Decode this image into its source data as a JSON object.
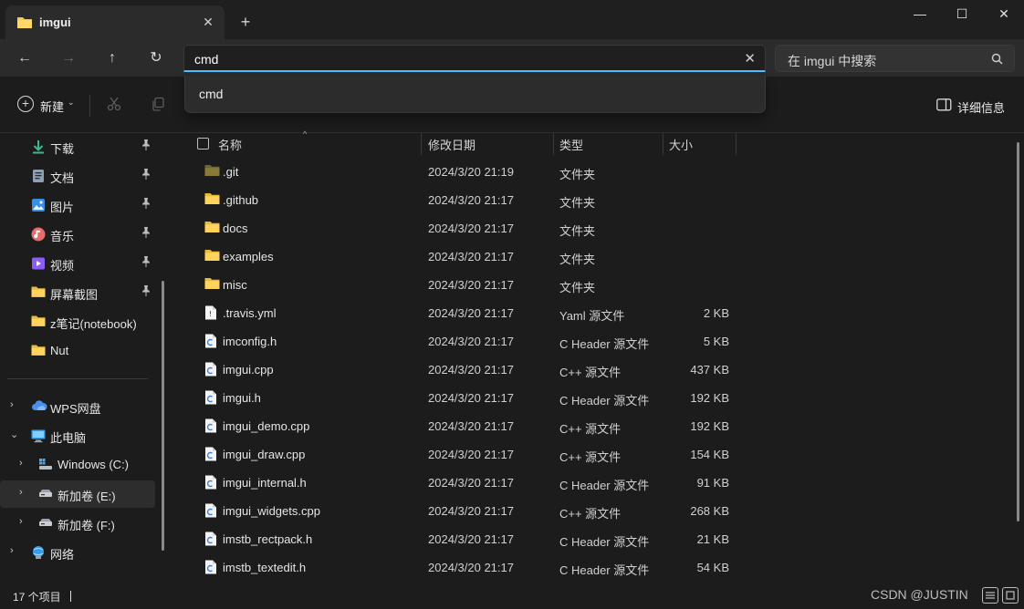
{
  "window": {
    "tab_title": "imgui",
    "tab_close": "✕",
    "new_tab": "+",
    "minimize": "—",
    "maximize": "☐",
    "close": "✕"
  },
  "nav": {
    "back": "←",
    "forward": "→",
    "up": "↑",
    "refresh": "↻",
    "address_value": "cmd",
    "address_clear": "✕",
    "search_placeholder": "在 imgui 中搜索",
    "suggestion": "cmd"
  },
  "commandbar": {
    "new_label": "新建",
    "new_plus": "+",
    "new_chevron": "⌄",
    "details_label": "详细信息"
  },
  "sidebar": {
    "quick_access": [
      {
        "label": "下载",
        "icon": "download-icon",
        "pinned": true
      },
      {
        "label": "文档",
        "icon": "document-icon",
        "pinned": true
      },
      {
        "label": "图片",
        "icon": "pictures-icon",
        "pinned": true
      },
      {
        "label": "音乐",
        "icon": "music-icon",
        "pinned": true
      },
      {
        "label": "视频",
        "icon": "video-icon",
        "pinned": true
      },
      {
        "label": "屏幕截图",
        "icon": "folder-icon",
        "pinned": true
      },
      {
        "label": "z笔记(notebook)",
        "icon": "folder-icon",
        "pinned": false
      },
      {
        "label": "Nut",
        "icon": "folder-icon",
        "pinned": false
      }
    ],
    "tree": [
      {
        "label": "WPS网盘",
        "icon": "cloud-icon",
        "arrow": "›"
      },
      {
        "label": "此电脑",
        "icon": "computer-icon",
        "arrow": "⌄"
      },
      {
        "label": "Windows (C:)",
        "icon": "drive-icon",
        "arrow": "›"
      },
      {
        "label": "新加卷 (E:)",
        "icon": "drive-icon",
        "arrow": "›"
      },
      {
        "label": "新加卷 (F:)",
        "icon": "drive-icon",
        "arrow": "›"
      },
      {
        "label": "网络",
        "icon": "network-icon",
        "arrow": "›"
      }
    ],
    "pin_glyph": "📌"
  },
  "columns": {
    "name": "名称",
    "date": "修改日期",
    "type": "类型",
    "size": "大小",
    "sort_caret": "^"
  },
  "files": [
    {
      "name": ".git",
      "date": "2024/3/20 21:19",
      "type": "文件夹",
      "size": "",
      "kind": "folder-dark"
    },
    {
      "name": ".github",
      "date": "2024/3/20 21:17",
      "type": "文件夹",
      "size": "",
      "kind": "folder"
    },
    {
      "name": "docs",
      "date": "2024/3/20 21:17",
      "type": "文件夹",
      "size": "",
      "kind": "folder"
    },
    {
      "name": "examples",
      "date": "2024/3/20 21:17",
      "type": "文件夹",
      "size": "",
      "kind": "folder"
    },
    {
      "name": "misc",
      "date": "2024/3/20 21:17",
      "type": "文件夹",
      "size": "",
      "kind": "folder"
    },
    {
      "name": ".travis.yml",
      "date": "2024/3/20 21:17",
      "type": "Yaml 源文件",
      "size": "2 KB",
      "kind": "yaml"
    },
    {
      "name": "imconfig.h",
      "date": "2024/3/20 21:17",
      "type": "C Header 源文件",
      "size": "5 KB",
      "kind": "code"
    },
    {
      "name": "imgui.cpp",
      "date": "2024/3/20 21:17",
      "type": "C++ 源文件",
      "size": "437 KB",
      "kind": "code"
    },
    {
      "name": "imgui.h",
      "date": "2024/3/20 21:17",
      "type": "C Header 源文件",
      "size": "192 KB",
      "kind": "code"
    },
    {
      "name": "imgui_demo.cpp",
      "date": "2024/3/20 21:17",
      "type": "C++ 源文件",
      "size": "192 KB",
      "kind": "code"
    },
    {
      "name": "imgui_draw.cpp",
      "date": "2024/3/20 21:17",
      "type": "C++ 源文件",
      "size": "154 KB",
      "kind": "code"
    },
    {
      "name": "imgui_internal.h",
      "date": "2024/3/20 21:17",
      "type": "C Header 源文件",
      "size": "91 KB",
      "kind": "code"
    },
    {
      "name": "imgui_widgets.cpp",
      "date": "2024/3/20 21:17",
      "type": "C++ 源文件",
      "size": "268 KB",
      "kind": "code"
    },
    {
      "name": "imstb_rectpack.h",
      "date": "2024/3/20 21:17",
      "type": "C Header 源文件",
      "size": "21 KB",
      "kind": "code"
    },
    {
      "name": "imstb_textedit.h",
      "date": "2024/3/20 21:17",
      "type": "C Header 源文件",
      "size": "54 KB",
      "kind": "code"
    }
  ],
  "status": {
    "item_count": "17 个项目",
    "watermark": "CSDN @JUSTIN"
  },
  "colors": {
    "accent": "#4cc2ff",
    "folder": "#f7c948",
    "folder_dark": "#8a7a3a"
  }
}
